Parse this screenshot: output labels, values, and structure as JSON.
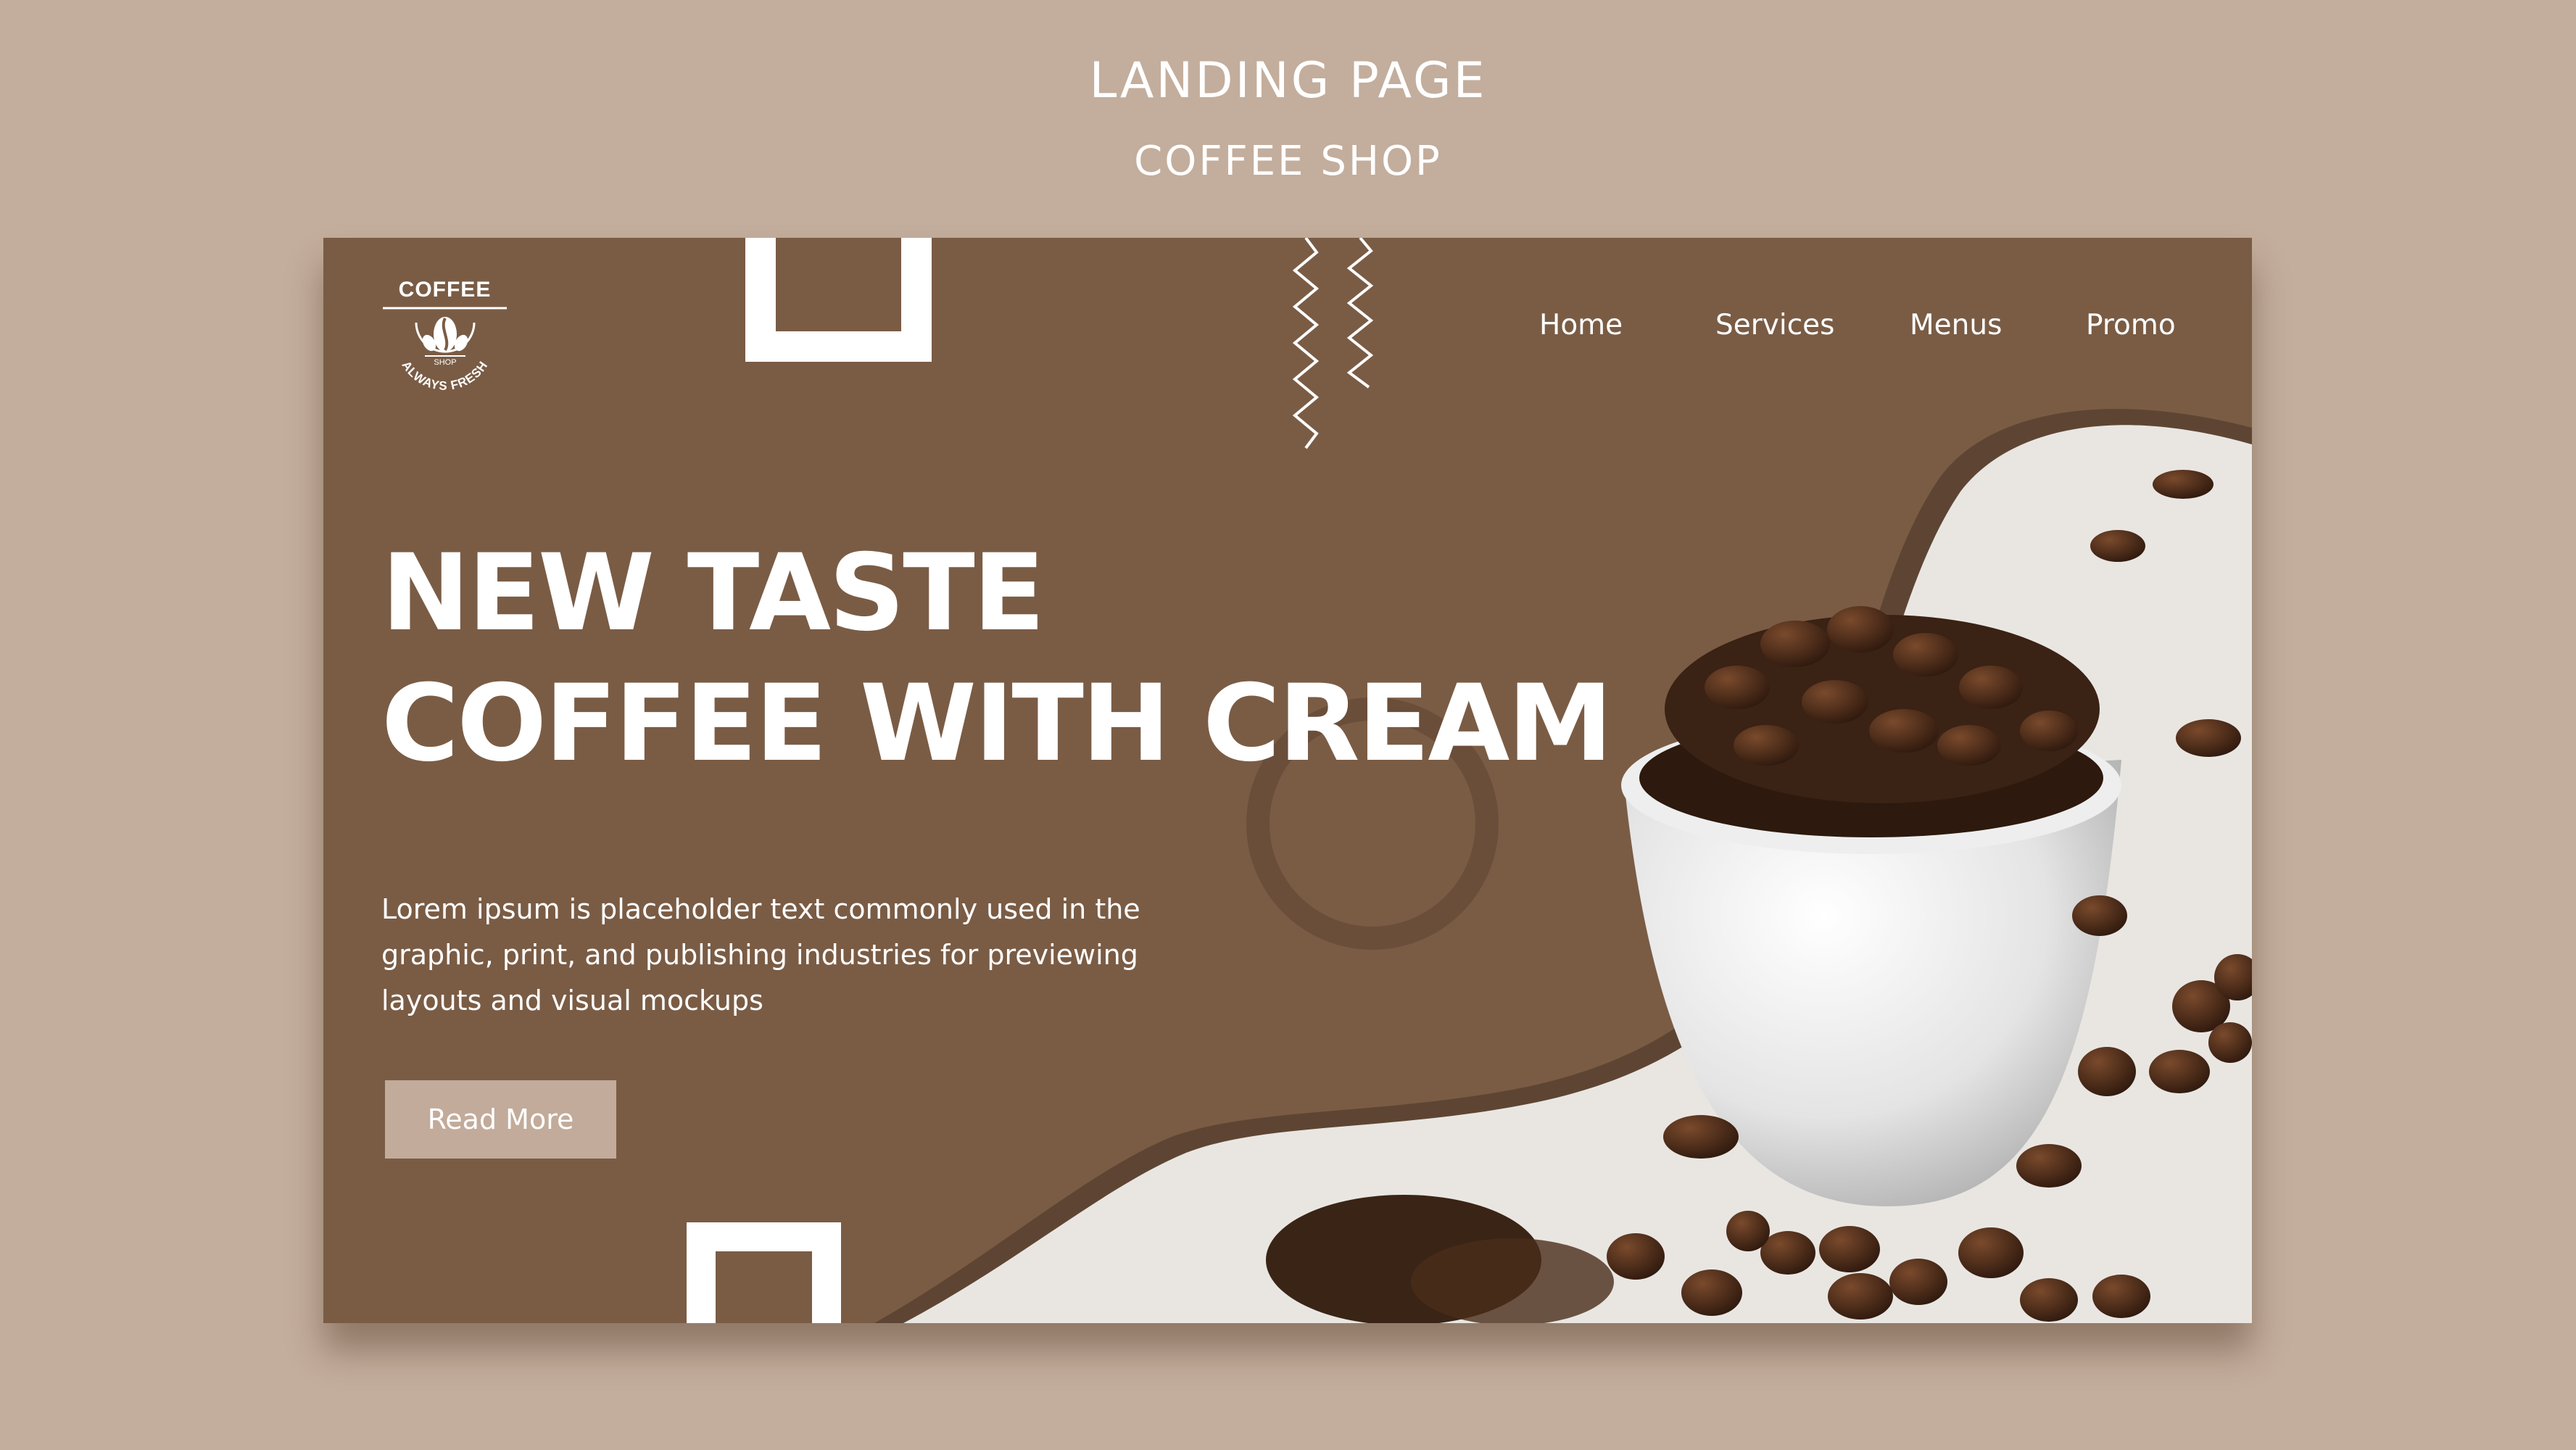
{
  "heading": {
    "title": "LANDING PAGE",
    "subtitle": "COFFEE SHOP"
  },
  "logo": {
    "word": "COFFEE",
    "badge": "SHOP",
    "tagline": "ALWAYS FRESH"
  },
  "nav": {
    "items": [
      {
        "label": "Home"
      },
      {
        "label": "Services"
      },
      {
        "label": "Menus"
      },
      {
        "label": "Promo"
      }
    ]
  },
  "hero": {
    "title_line1": "NEW TASTE",
    "title_line2": "COFFEE WITH CREAM",
    "description": "Lorem ipsum is placeholder text commonly used in the graphic, print, and publishing industries for previewing layouts and visual mockups",
    "button_label": "Read More"
  },
  "colors": {
    "page_bg": "#c3ad9c",
    "panel_bg": "#7a5c45",
    "panel_dark": "#5e4533",
    "button_bg": "#c2ab9a",
    "text": "#ffffff"
  },
  "icons": {
    "logo": "coffee-bean-logo-icon"
  }
}
